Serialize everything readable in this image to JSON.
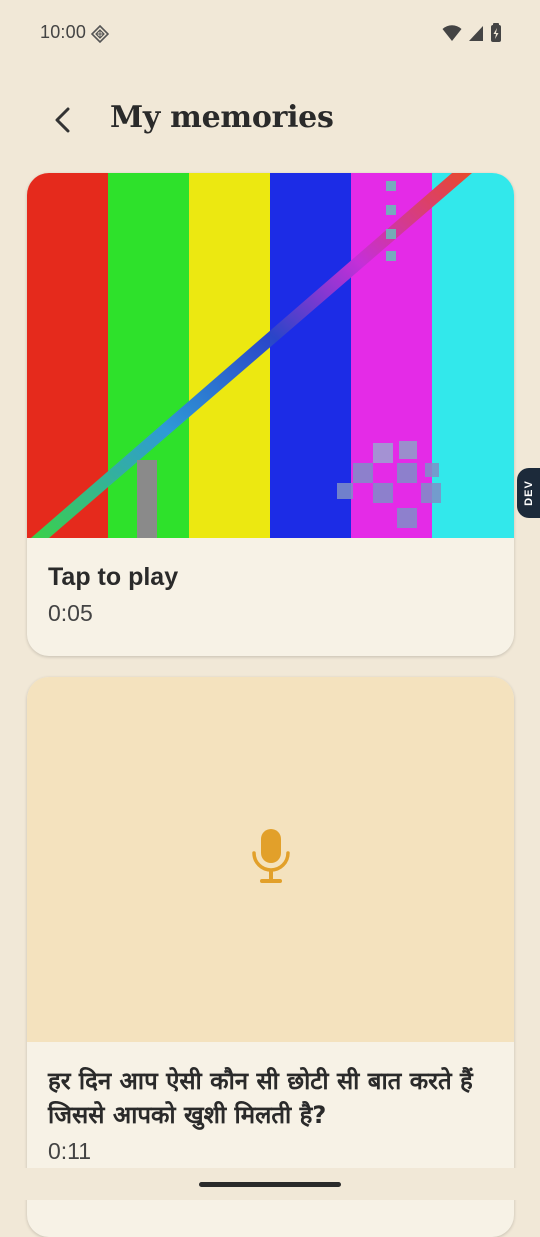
{
  "status_bar": {
    "time": "10:00",
    "icons": [
      "gemini-icon",
      "wifi-icon",
      "signal-icon",
      "battery-icon"
    ]
  },
  "header": {
    "back_icon": "arrow-back-icon",
    "title": "My memories"
  },
  "memories": [
    {
      "title": "Tap to play",
      "duration": "0:05",
      "thumbnail": "color-bars-video"
    },
    {
      "title": "हर दिन आप ऐसी कौन सी छोटी सी बात करते हैं जिससे आपको खुशी मिलती है?",
      "duration": "0:11",
      "thumbnail": "mic-icon"
    }
  ],
  "dev_badge": "DEV",
  "colors": {
    "background": "#F1E8D7",
    "card": "#F7F2E6",
    "mic_bg": "#F4E2BE",
    "mic": "#E2A02A"
  }
}
